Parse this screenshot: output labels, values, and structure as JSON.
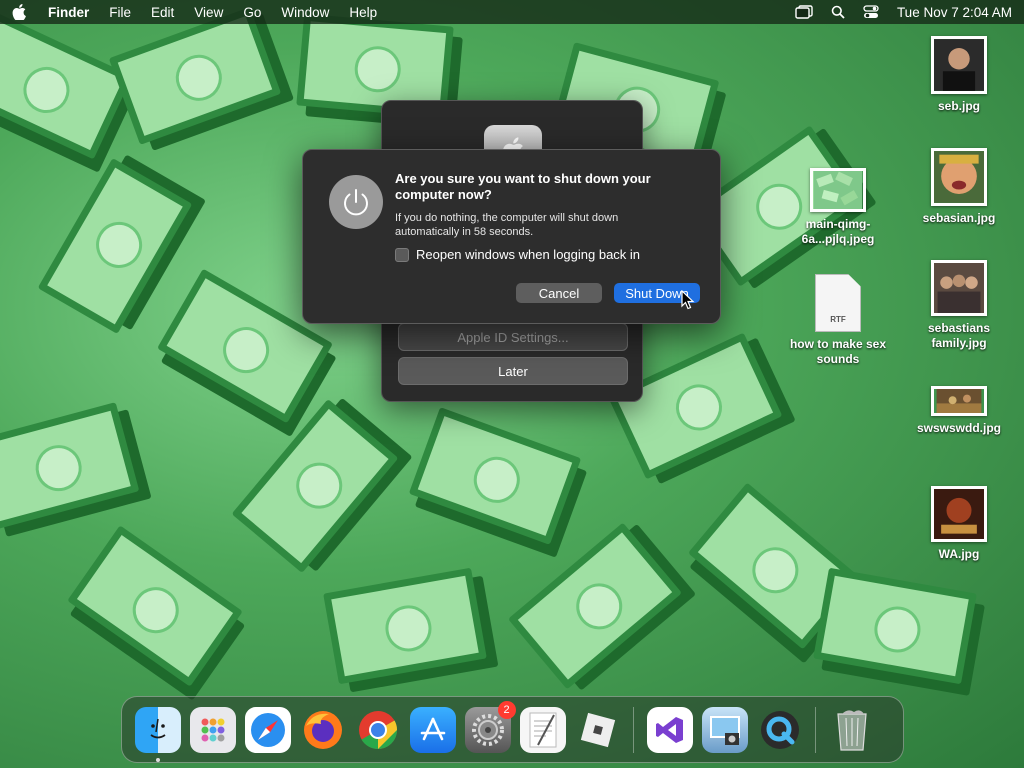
{
  "menubar": {
    "app_name": "Finder",
    "menus": [
      "File",
      "Edit",
      "View",
      "Go",
      "Window",
      "Help"
    ],
    "clock": "Tue Nov 7  2:04 AM"
  },
  "desktop_icons": [
    {
      "label": "seb.jpg"
    },
    {
      "label": "sebasian.jpg"
    },
    {
      "label": "sebastians family.jpg"
    },
    {
      "label": "swswswdd.jpg"
    },
    {
      "label": "WA.jpg"
    },
    {
      "label": "main-qimg-6a...pjlq.jpeg"
    },
    {
      "label": "how to make sex sounds",
      "doc_type": "RTF"
    }
  ],
  "background_panel": {
    "apple_id_button": "Apple ID Settings...",
    "later_button": "Later"
  },
  "alert": {
    "title": "Are you sure you want to shut down your computer now?",
    "body": "If you do nothing, the computer will shut down automatically in 58 seconds.",
    "checkbox_label": "Reopen windows when logging back in",
    "checkbox_checked": false,
    "cancel_button": "Cancel",
    "shutdown_button": "Shut Down"
  },
  "dock": {
    "items": [
      "finder-icon",
      "launchpad-icon",
      "safari-icon",
      "firefox-icon",
      "chrome-icon",
      "app-store-icon",
      "system-settings-icon",
      "textedit-icon",
      "roblox-icon",
      "visual-studio-icon",
      "preview-icon",
      "quicktime-icon",
      "trash-icon"
    ],
    "system_settings_badge": "2"
  },
  "colors": {
    "accent": "#1f6fe0",
    "badge": "#ff3b30",
    "wallpaper_green": "#4da85a"
  }
}
